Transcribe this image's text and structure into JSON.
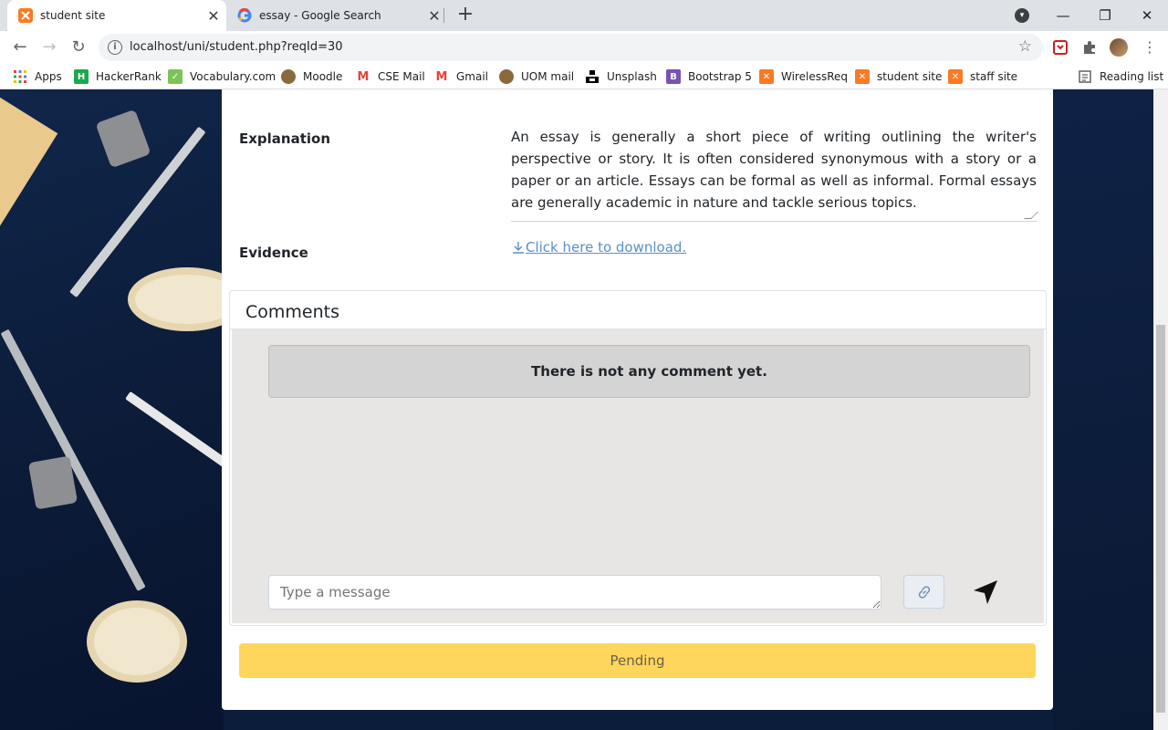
{
  "browser": {
    "tabs": [
      {
        "title": "student site",
        "active": true,
        "favicon": "xampp-icon"
      },
      {
        "title": "essay - Google Search",
        "active": false,
        "favicon": "google-icon"
      }
    ],
    "url": "localhost/uni/student.php?reqId=30",
    "bookmarks": [
      {
        "label": "Apps",
        "icon": "apps-grid-icon"
      },
      {
        "label": "HackerRank",
        "icon": "hackerrank-icon"
      },
      {
        "label": "Vocabulary.com",
        "icon": "vocabulary-icon"
      },
      {
        "label": "Moodle",
        "icon": "moodle-icon"
      },
      {
        "label": "CSE Mail",
        "icon": "gmail-icon"
      },
      {
        "label": "Gmail",
        "icon": "gmail-icon"
      },
      {
        "label": "UOM mail",
        "icon": "uom-icon"
      },
      {
        "label": "Unsplash",
        "icon": "unsplash-icon"
      },
      {
        "label": "Bootstrap 5",
        "icon": "bootstrap-icon"
      },
      {
        "label": "WirelessReq",
        "icon": "xampp-icon"
      },
      {
        "label": "student site",
        "icon": "xampp-icon"
      },
      {
        "label": "staff site",
        "icon": "xampp-icon"
      }
    ],
    "reading_list": "Reading list"
  },
  "request": {
    "explanation_label": "Explanation",
    "explanation_text": "An essay is generally a short piece of writing outlining the writer's perspective or story. It is often considered synonymous with a story or a paper or an article. Essays can be formal as well as informal. Formal essays are generally academic in nature and tackle serious topics.",
    "evidence_label": "Evidence",
    "download_link": " Click here to download."
  },
  "comments": {
    "title": "Comments",
    "empty_message": "There is not any comment yet.",
    "input_placeholder": "Type a message"
  },
  "status": {
    "label": "Pending",
    "color": "#ffd65c"
  },
  "colors": {
    "xampp": "#fb7a24",
    "link": "#5a8fc8",
    "comments_bg": "#e7e6e4"
  }
}
